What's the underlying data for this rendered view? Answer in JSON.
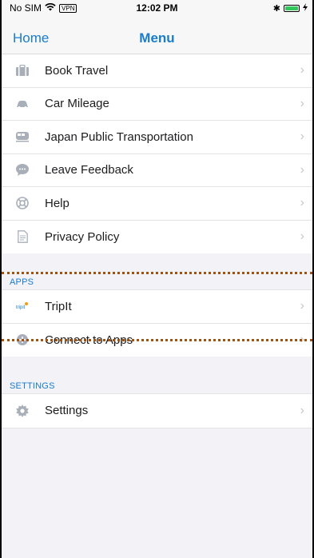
{
  "status_bar": {
    "carrier": "No SIM",
    "vpn": "VPN",
    "time": "12:02 PM",
    "bluetooth": "✱"
  },
  "nav": {
    "back_label": "Home",
    "title": "Menu"
  },
  "main_menu": [
    {
      "label": "Book Travel",
      "icon": "briefcase-icon"
    },
    {
      "label": "Car Mileage",
      "icon": "car-icon"
    },
    {
      "label": "Japan Public Transportation",
      "icon": "train-icon"
    },
    {
      "label": "Leave Feedback",
      "icon": "speech-bubble-icon"
    },
    {
      "label": "Help",
      "icon": "lifebuoy-icon"
    },
    {
      "label": "Privacy Policy",
      "icon": "document-icon"
    }
  ],
  "apps_section": {
    "header": "APPS",
    "items": [
      {
        "label": "TripIt",
        "icon": "tripit-logo-icon"
      },
      {
        "label": "Connect to Apps",
        "icon": "connect-apps-icon"
      }
    ]
  },
  "settings_section": {
    "header": "SETTINGS",
    "items": [
      {
        "label": "Settings",
        "icon": "gear-icon"
      }
    ]
  },
  "colors": {
    "accent": "#1a7ccf",
    "icon_gray": "#a9afb8",
    "overlay_dots": "#a3510f"
  }
}
